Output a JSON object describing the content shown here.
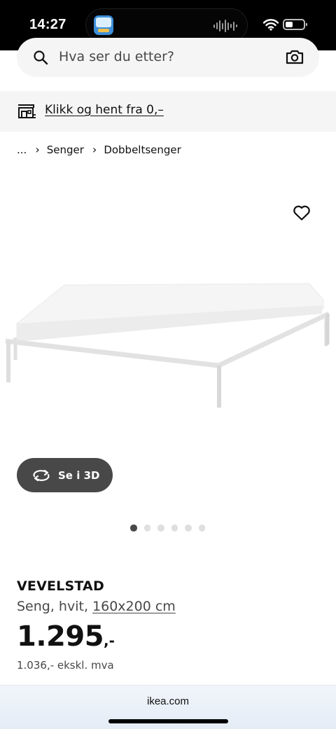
{
  "status_bar": {
    "time": "14:27",
    "icons": [
      "app-icon",
      "sound-wave-icon",
      "wifi-icon",
      "battery-icon"
    ]
  },
  "search": {
    "placeholder": "Hva ser du etter?",
    "icons": [
      "search-icon",
      "camera-icon"
    ]
  },
  "pickup_banner": {
    "icon": "store-icon",
    "link_text": "Klikk og hent fra 0,–"
  },
  "breadcrumb": {
    "ellipsis": "...",
    "separator": "›",
    "items": [
      "Senger",
      "Dobbeltsenger"
    ]
  },
  "gallery": {
    "favorite_icon": "heart-icon",
    "view_3d_label": "Se i 3D",
    "view_3d_icon": "rotate-icon",
    "image_count": 6,
    "active_index": 0
  },
  "product": {
    "name": "VEVELSTAD",
    "description": "Seng, hvit,",
    "size": "160x200 cm",
    "price": "1.295",
    "price_suffix": ",-",
    "price_ex_vat": "1.036,- ekskl. mva"
  },
  "browser": {
    "url": "ikea.com"
  },
  "colors": {
    "text_primary": "#111111",
    "text_secondary": "#484848",
    "surface_grey": "#f5f5f5",
    "button_dark": "#484848",
    "dot_inactive": "#dfdfdf"
  }
}
